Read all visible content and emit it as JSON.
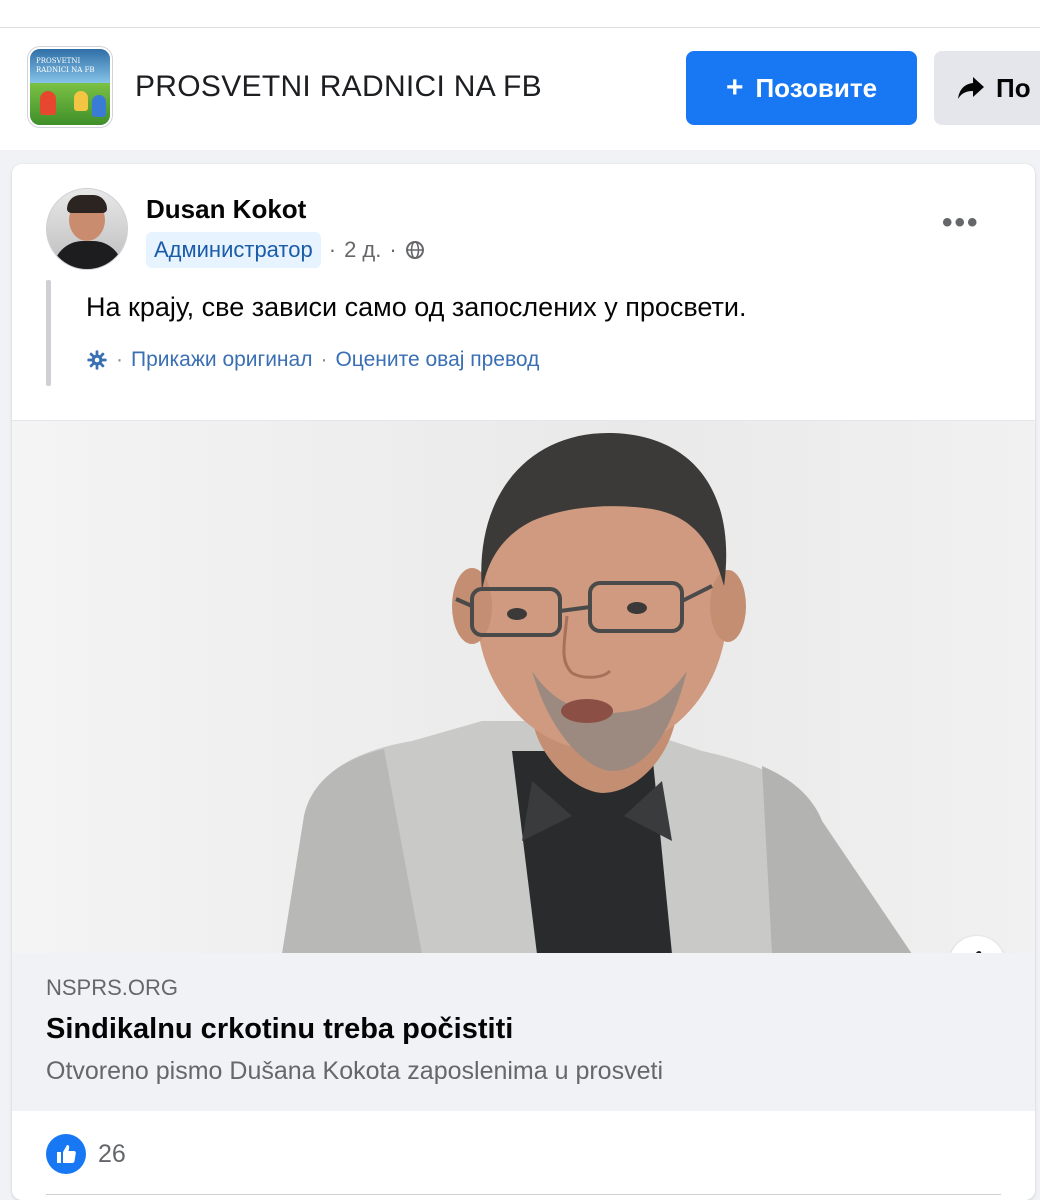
{
  "group": {
    "name": "PROSVETNI RADNICI NA FB",
    "avatar_text": "PROSVETNI RADNICI NA FB",
    "invite_label": "Позовите",
    "share_label": "По"
  },
  "post": {
    "author": "Dusan Kokot",
    "role": "Администратор",
    "time": "2 д.",
    "text": "На крају, све зависи само од запослених у просвети.",
    "translation": {
      "show_original": "Прикажи оригинал",
      "rate": "Оцените овај превод"
    },
    "link": {
      "domain": "NSPRS.ORG",
      "title": "Sindikalnu crkotinu treba počistiti",
      "description": "Otvoreno pismo Dušana Kokota zaposlenima u prosveti"
    },
    "reaction_count": "26"
  },
  "icons": {
    "invite": "plus-icon",
    "share": "share-arrow-icon",
    "privacy": "globe-icon",
    "translation": "gear-icon",
    "more": "more-options-icon",
    "info": "info-icon",
    "reaction": "like-icon"
  },
  "colors": {
    "primary": "#1877f2",
    "background": "#f0f2f5",
    "card": "#ffffff",
    "secondary_text": "#65676b",
    "link_blue": "#3a6fb4"
  }
}
